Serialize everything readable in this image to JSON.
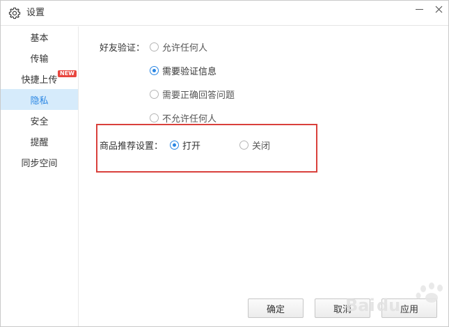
{
  "window": {
    "title": "设置",
    "title_icon": "gear-icon"
  },
  "sidebar": {
    "items": [
      {
        "label": "基本",
        "active": false
      },
      {
        "label": "传输",
        "active": false
      },
      {
        "label": "快捷上传",
        "active": false,
        "badge": "NEW"
      },
      {
        "label": "隐私",
        "active": true
      },
      {
        "label": "安全",
        "active": false
      },
      {
        "label": "提醒",
        "active": false
      },
      {
        "label": "同步空间",
        "active": false
      }
    ]
  },
  "friend_verification": {
    "label": "好友验证：",
    "options": [
      {
        "label": "允许任何人",
        "checked": false
      },
      {
        "label": "需要验证信息",
        "checked": true
      },
      {
        "label": "需要正确回答问题",
        "checked": false
      },
      {
        "label": "不允许任何人",
        "checked": false
      }
    ]
  },
  "product_recommend": {
    "label": "商品推荐设置：",
    "options": [
      {
        "label": "打开",
        "checked": true
      },
      {
        "label": "关闭",
        "checked": false
      }
    ]
  },
  "footer": {
    "ok_label": "确定",
    "cancel_label": "取消",
    "apply_label": "应用"
  },
  "colors": {
    "accent": "#2a86e3",
    "active_bg": "#d6ebfb",
    "highlight_border": "#d9403b",
    "badge": "#e8463f"
  }
}
